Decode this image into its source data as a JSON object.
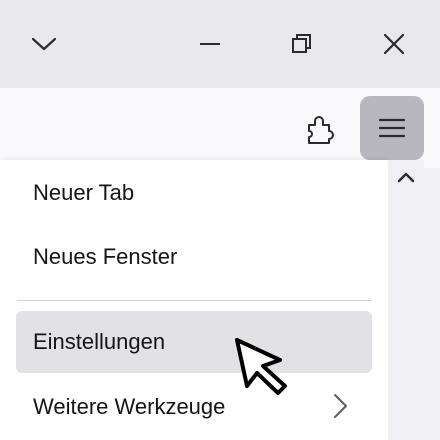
{
  "window": {
    "controls": {
      "list_tabs_icon": "chevron-down-icon",
      "minimize_icon": "minimize-icon",
      "restore_icon": "restore-icon",
      "close_icon": "close-icon"
    }
  },
  "toolbar": {
    "extensions_icon": "puzzle-piece-icon",
    "menu_icon": "hamburger-menu-icon",
    "menu_button_active_color": "#b7b7bd"
  },
  "app_menu": {
    "items": [
      {
        "label": "Neuer Tab"
      },
      {
        "label": "Neues Fenster"
      },
      {
        "label": "Einstellungen",
        "hovered": true
      },
      {
        "label": "Weitere Werkzeuge",
        "has_submenu": true
      }
    ],
    "hover_color": "#e1e1e6"
  },
  "scrollbar": {
    "up_icon": "chevron-up-icon"
  }
}
